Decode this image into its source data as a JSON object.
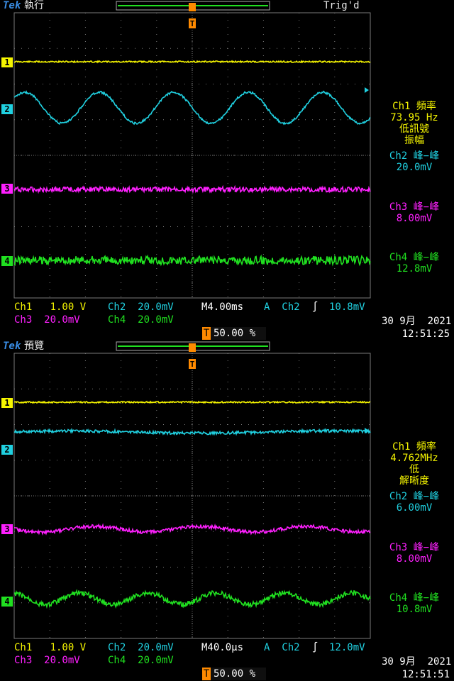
{
  "screens": [
    {
      "mode": "執行",
      "trig_status": "Trig'd",
      "brand": "Tek",
      "meas_ch1": [
        "Ch1 頻率",
        "73.95 Hz",
        "低訊號",
        "振幅"
      ],
      "meas_ch2": [
        "Ch2 峰−峰",
        "20.0mV"
      ],
      "meas_ch3": [
        "Ch3 峰−峰",
        "8.00mV"
      ],
      "meas_ch4": [
        "Ch4 峰−峰",
        "12.8mV"
      ],
      "ch1_scale": "Ch1   1.00 V",
      "ch2_scale": "Ch2  20.0mV",
      "ch3_scale": "Ch3  20.0mV",
      "ch4_scale": "Ch4  20.0mV",
      "timebase": "M4.00ms",
      "trig_src": "A  Ch2",
      "trig_level": "10.8mV",
      "trig_pos": "50.00 %",
      "date": "30 9月  2021",
      "time": "12:51:25"
    },
    {
      "mode": "預覽",
      "trig_status": "",
      "brand": "Tek",
      "meas_ch1": [
        "Ch1 頻率",
        "4.762MHz",
        "低",
        "解晰度"
      ],
      "meas_ch2": [
        "Ch2 峰−峰",
        "6.00mV"
      ],
      "meas_ch3": [
        "Ch3 峰−峰",
        "8.00mV"
      ],
      "meas_ch4": [
        "Ch4 峰−峰",
        "10.8mV"
      ],
      "ch1_scale": "Ch1   1.00 V",
      "ch2_scale": "Ch2  20.0mV",
      "ch3_scale": "Ch3  20.0mV",
      "ch4_scale": "Ch4  20.0mV",
      "timebase": "M40.0µs",
      "trig_src": "A  Ch2",
      "trig_level": "12.0mV",
      "trig_pos": "50.00 %",
      "date": "30 9月  2021",
      "time": "12:51:51"
    }
  ],
  "colors": {
    "ch1": "#f5f500",
    "ch2": "#20d0e0",
    "ch3": "#ff20ff",
    "ch4": "#20e020",
    "grid": "#7a7a7a",
    "trigger": "#ff8a00"
  }
}
